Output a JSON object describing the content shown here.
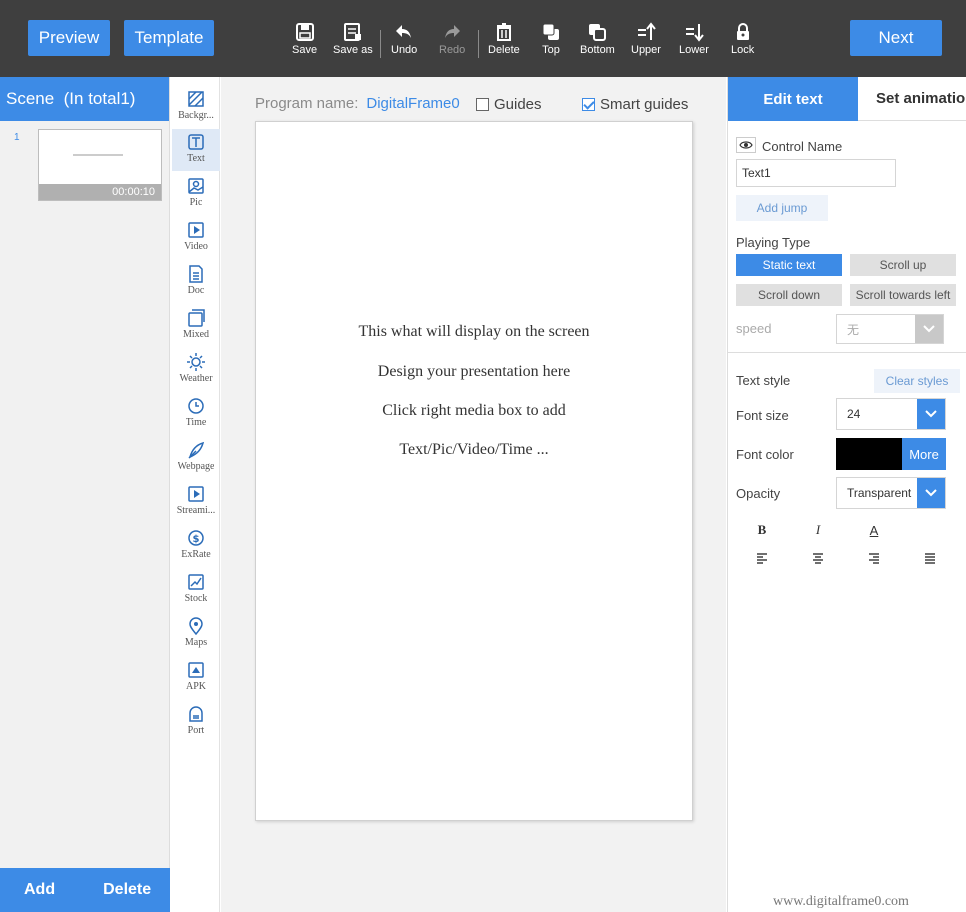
{
  "toolbar": {
    "preview_label": "Preview",
    "template_label": "Template",
    "next_label": "Next",
    "tools": [
      {
        "label": "Save",
        "icon": "save-icon"
      },
      {
        "label": "Save as",
        "icon": "save-as-icon"
      },
      {
        "label": "Undo",
        "icon": "undo-icon"
      },
      {
        "label": "Redo",
        "icon": "redo-icon"
      },
      {
        "label": "Delete",
        "icon": "trash-icon"
      },
      {
        "label": "Top",
        "icon": "bring-to-top-icon"
      },
      {
        "label": "Bottom",
        "icon": "send-to-bottom-icon"
      },
      {
        "label": "Upper",
        "icon": "move-up-icon"
      },
      {
        "label": "Lower",
        "icon": "move-down-icon"
      },
      {
        "label": "Lock",
        "icon": "lock-icon"
      }
    ]
  },
  "scene_panel": {
    "header": "Scene  (In total1)",
    "scene_number": "1",
    "scene_duration": "00:00:10",
    "add_label": "Add",
    "delete_label": "Delete"
  },
  "media": [
    {
      "label": "Backgr...",
      "icon": "background-icon"
    },
    {
      "label": "Text",
      "icon": "text-icon"
    },
    {
      "label": "Pic",
      "icon": "picture-icon"
    },
    {
      "label": "Video",
      "icon": "video-icon"
    },
    {
      "label": "Doc",
      "icon": "document-icon"
    },
    {
      "label": "Mixed",
      "icon": "mixed-icon"
    },
    {
      "label": "Weather",
      "icon": "weather-icon"
    },
    {
      "label": "Time",
      "icon": "clock-icon"
    },
    {
      "label": "Webpage",
      "icon": "webpage-icon"
    },
    {
      "label": "Streami...",
      "icon": "streaming-icon"
    },
    {
      "label": "ExRate",
      "icon": "exchange-rate-icon"
    },
    {
      "label": "Stock",
      "icon": "stock-icon"
    },
    {
      "label": "Maps",
      "icon": "map-pin-icon"
    },
    {
      "label": "APK",
      "icon": "apk-icon"
    },
    {
      "label": "Port",
      "icon": "port-icon"
    }
  ],
  "work_area": {
    "program_label": "Program name:",
    "program_name": "DigitalFrame0",
    "guides_label": "Guides",
    "smart_guides_label": "Smart guides",
    "canvas_lines": [
      "This what will display on the screen",
      "Design your presentation here",
      "Click right media box to add",
      "Text/Pic/Video/Time ..."
    ]
  },
  "right_panel": {
    "tab_edit": "Edit text",
    "tab_anim": "Set animation",
    "control_name_label": "Control Name",
    "control_name_value": "Text1",
    "add_jump": "Add jump",
    "playing_type_label": "Playing Type",
    "play_types": [
      "Static text",
      "Scroll up",
      "Scroll down",
      "Scroll towards left"
    ],
    "speed_label": "speed",
    "speed_value": "无",
    "text_style_label": "Text style",
    "clear_styles": "Clear styles",
    "font_size_label": "Font size",
    "font_size_value": "24",
    "font_color_label": "Font color",
    "font_color_hex": "#000000",
    "more_label": "More",
    "opacity_label": "Opacity",
    "opacity_value": "Transparent",
    "style_buttons": {
      "bold": "B",
      "italic": "I",
      "font_color": "A"
    }
  },
  "watermark": "www.digitalframe0.com",
  "colors": {
    "accent": "#3d8be6",
    "toolbar_bg": "#3f3f3f"
  }
}
